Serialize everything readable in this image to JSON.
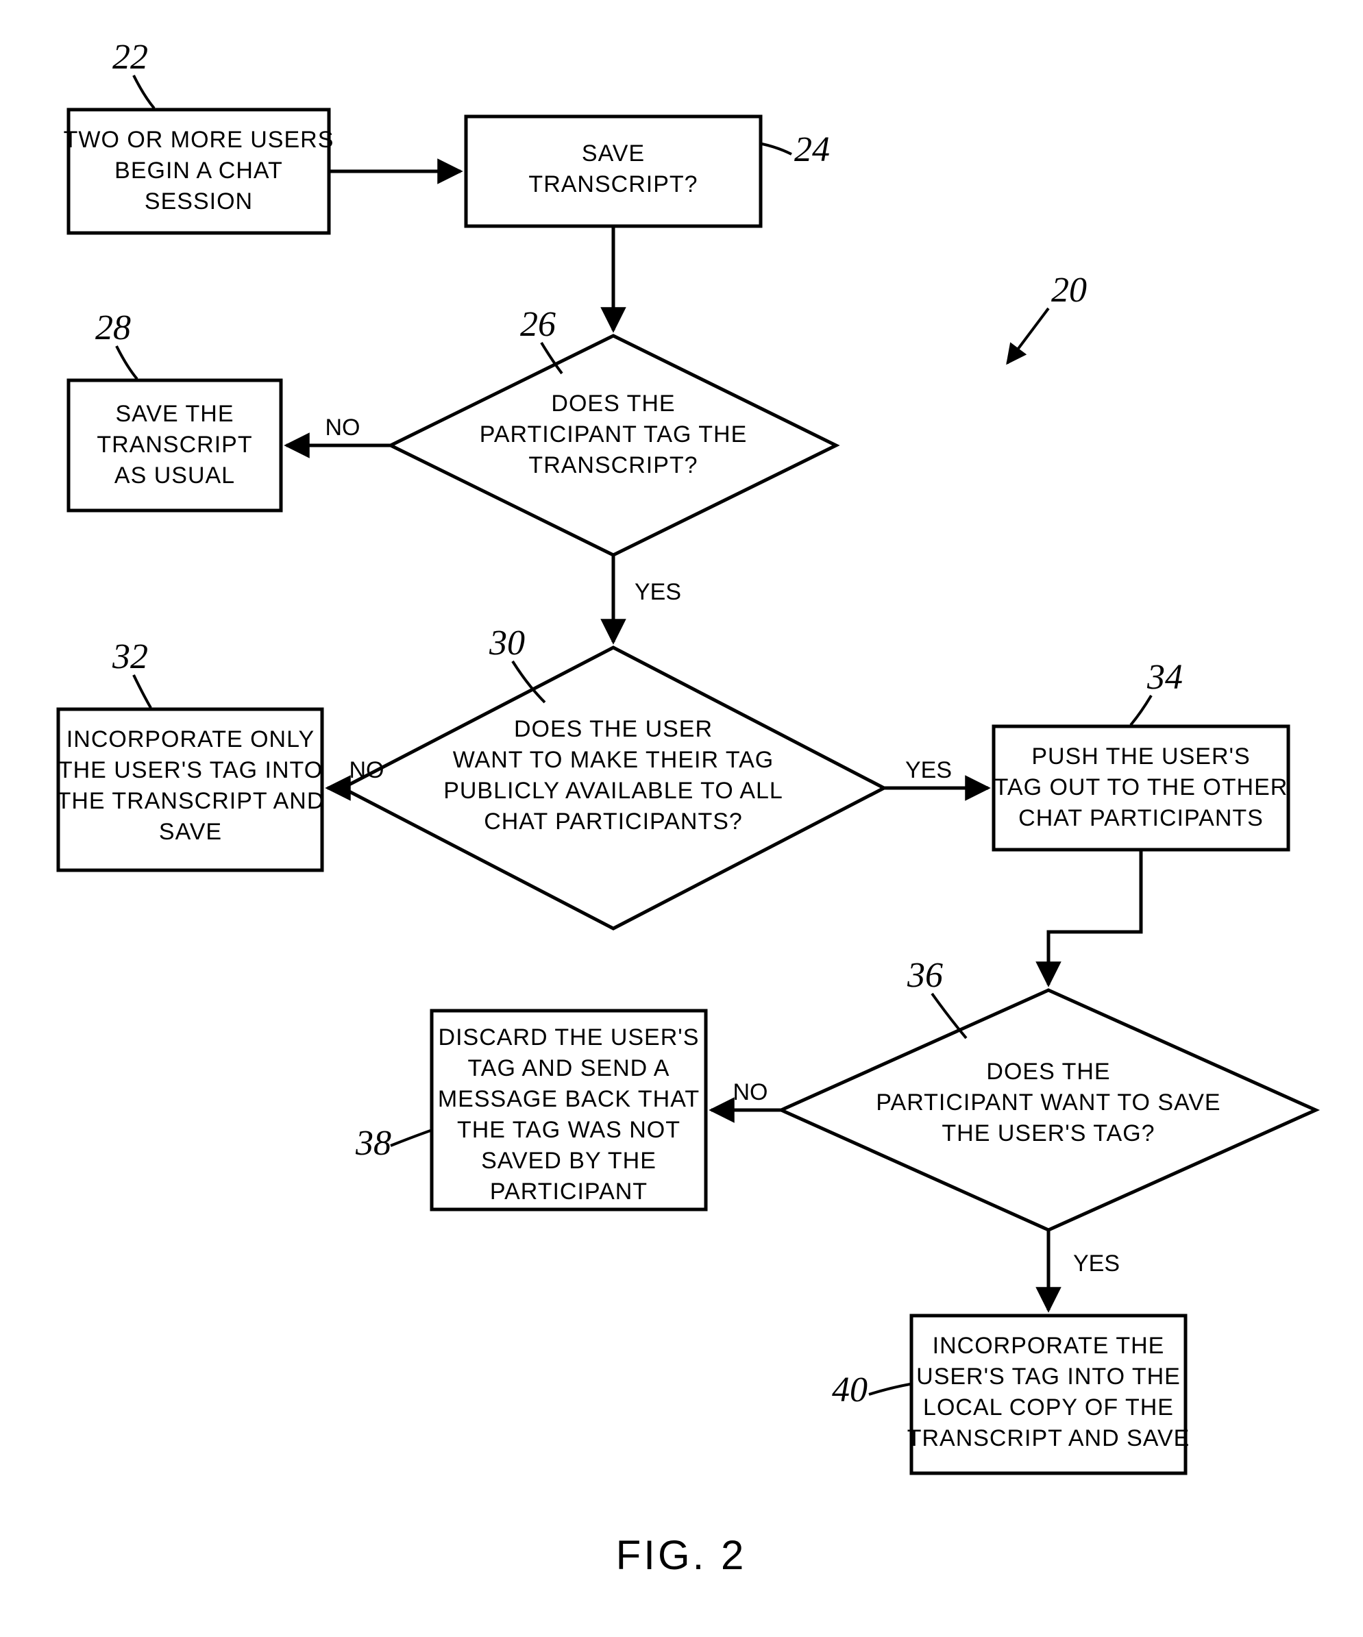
{
  "figure_label": "FIG. 2",
  "overall_ref": "20",
  "nodes": {
    "n22": {
      "ref": "22",
      "lines": [
        "TWO OR MORE USERS",
        "BEGIN A CHAT",
        "SESSION"
      ]
    },
    "n24": {
      "ref": "24",
      "lines": [
        "SAVE",
        "TRANSCRIPT?"
      ]
    },
    "n26": {
      "ref": "26",
      "lines": [
        "DOES THE",
        "PARTICIPANT TAG THE",
        "TRANSCRIPT?"
      ]
    },
    "n28": {
      "ref": "28",
      "lines": [
        "SAVE THE",
        "TRANSCRIPT",
        "AS USUAL"
      ]
    },
    "n30": {
      "ref": "30",
      "lines": [
        "DOES THE USER",
        "WANT TO MAKE THEIR TAG",
        "PUBLICLY AVAILABLE TO ALL",
        "CHAT PARTICIPANTS?"
      ]
    },
    "n32": {
      "ref": "32",
      "lines": [
        "INCORPORATE ONLY",
        "THE USER'S TAG INTO",
        "THE TRANSCRIPT AND",
        "SAVE"
      ]
    },
    "n34": {
      "ref": "34",
      "lines": [
        "PUSH THE USER'S",
        "TAG OUT TO THE OTHER",
        "CHAT PARTICIPANTS"
      ]
    },
    "n36": {
      "ref": "36",
      "lines": [
        "DOES THE",
        "PARTICIPANT WANT TO SAVE",
        "THE USER'S TAG?"
      ]
    },
    "n38": {
      "ref": "38",
      "lines": [
        "DISCARD THE USER'S",
        "TAG AND SEND A",
        "MESSAGE BACK THAT",
        "THE TAG WAS NOT",
        "SAVED BY THE",
        "PARTICIPANT"
      ]
    },
    "n40": {
      "ref": "40",
      "lines": [
        "INCORPORATE THE",
        "USER'S TAG INTO THE",
        "LOCAL COPY OF THE",
        "TRANSCRIPT AND SAVE"
      ]
    }
  },
  "edge_labels": {
    "no": "NO",
    "yes": "YES"
  }
}
